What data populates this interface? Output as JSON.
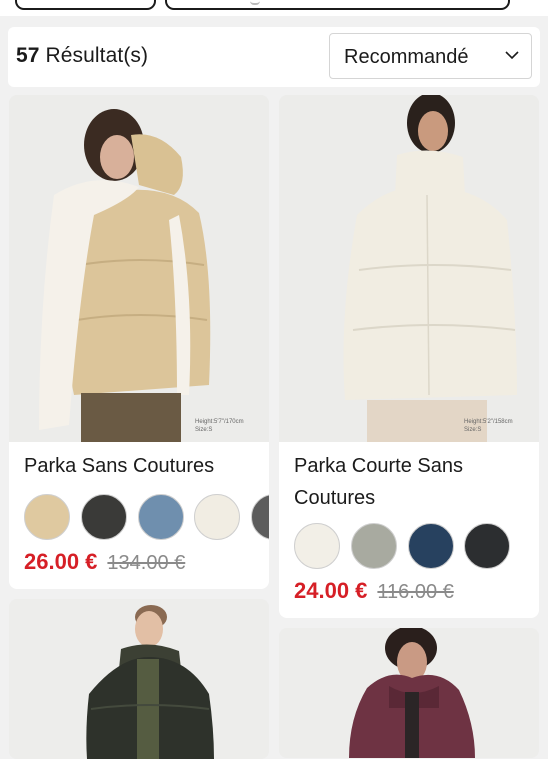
{
  "results": {
    "count": "57",
    "suffix": " Résultat(s)"
  },
  "sort": {
    "label": "Recommandé"
  },
  "products": [
    {
      "title": "Parka Sans Coutures",
      "price": "26.00 €",
      "old_price": "134.00 €",
      "image_label": "Height:5'7\"/170cm\nSize:S",
      "swatches": [
        "#dfc9a0",
        "#3a3a38",
        "#6f8fae",
        "#f1ede3",
        "#5c5c5c"
      ]
    },
    {
      "title": "Parka Courte Sans Coutures",
      "price": "24.00 €",
      "old_price": "116.00 €",
      "image_label": "Height:5'2\"/158cm\nSize:S",
      "swatches": [
        "#f2efe7",
        "#a8aaa0",
        "#27415f",
        "#2c2e30"
      ]
    },
    {
      "title": "",
      "image_label": ""
    },
    {
      "title": "",
      "image_label": ""
    }
  ],
  "colors": {
    "price": "#d61f26",
    "accent": "#1b1b1b"
  }
}
